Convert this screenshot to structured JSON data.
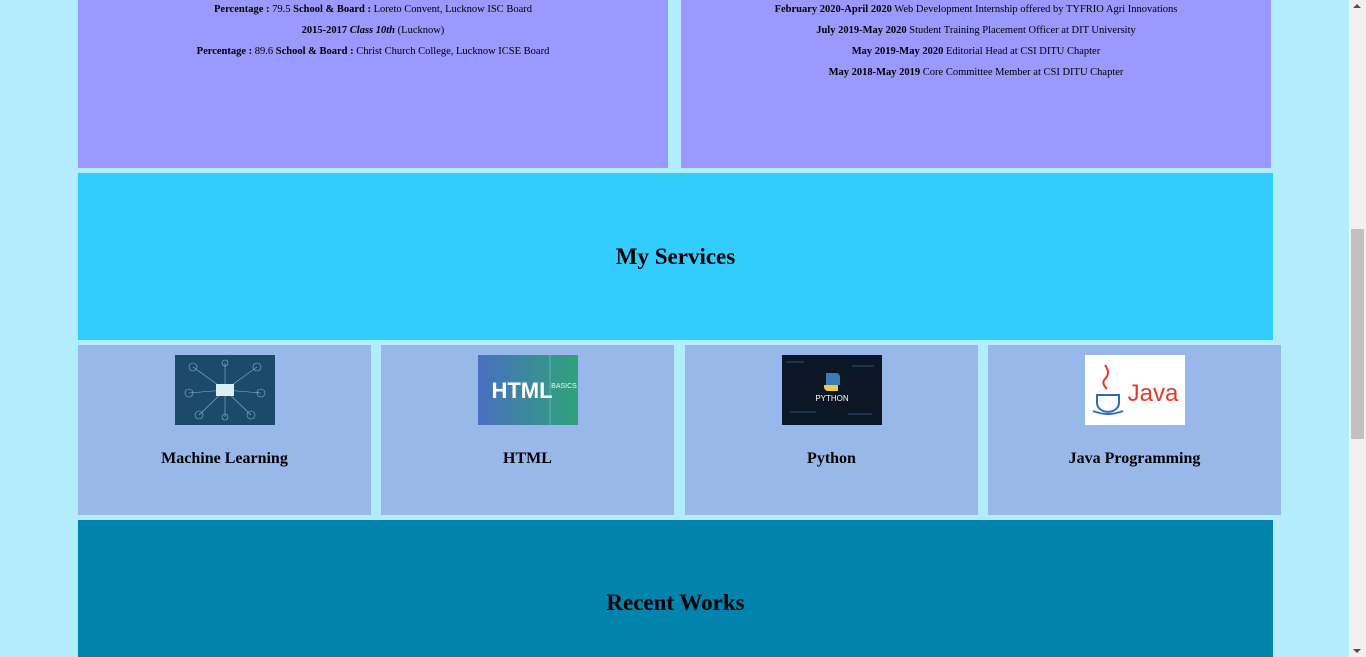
{
  "education": [
    {
      "k1": "Percentage :",
      "v1": " 79.5 ",
      "k2": "School & Board :",
      "v2": " Loreto Convent, Lucknow ISC Board"
    },
    {
      "k1": "2015-2017",
      "v1": " ",
      "k2": "Class 10th",
      "v2": " (Lucknow)"
    },
    {
      "k1": "Percentage :",
      "v1": " 89.6 ",
      "k2": "School & Board :",
      "v2": " Christ Church College, Lucknow ICSE Board"
    }
  ],
  "experience": [
    {
      "period": "February 2020-April 2020",
      "desc": " Web Development Internship offered by TYFRIO Agri Innovations"
    },
    {
      "period": "July 2019-May 2020",
      "desc": " Student Training Placement Officer at DIT University"
    },
    {
      "period": "May 2019-May 2020",
      "desc": " Editorial Head at CSI DITU Chapter"
    },
    {
      "period": "May 2018-May 2019",
      "desc": " Core Committee Member at CSI DITU Chapter"
    }
  ],
  "services": {
    "title": "My Services",
    "cards": [
      {
        "title": "Machine Learning",
        "icon": "machine-learning-image"
      },
      {
        "title": "HTML",
        "icon": "html-image",
        "image_text": "HTML",
        "image_side_text": "BASICS"
      },
      {
        "title": "Python",
        "icon": "python-image",
        "image_text": "PYTHON"
      },
      {
        "title": "Java Programming",
        "icon": "java-logo-image",
        "image_text": "Java"
      }
    ]
  },
  "recent_works": {
    "title": "Recent Works"
  },
  "colors": {
    "page_bg": "#b3ecfc",
    "panel": "#9999ff",
    "services_banner": "#33ccff",
    "card": "#99b8ea",
    "works_banner": "#0084ad"
  }
}
